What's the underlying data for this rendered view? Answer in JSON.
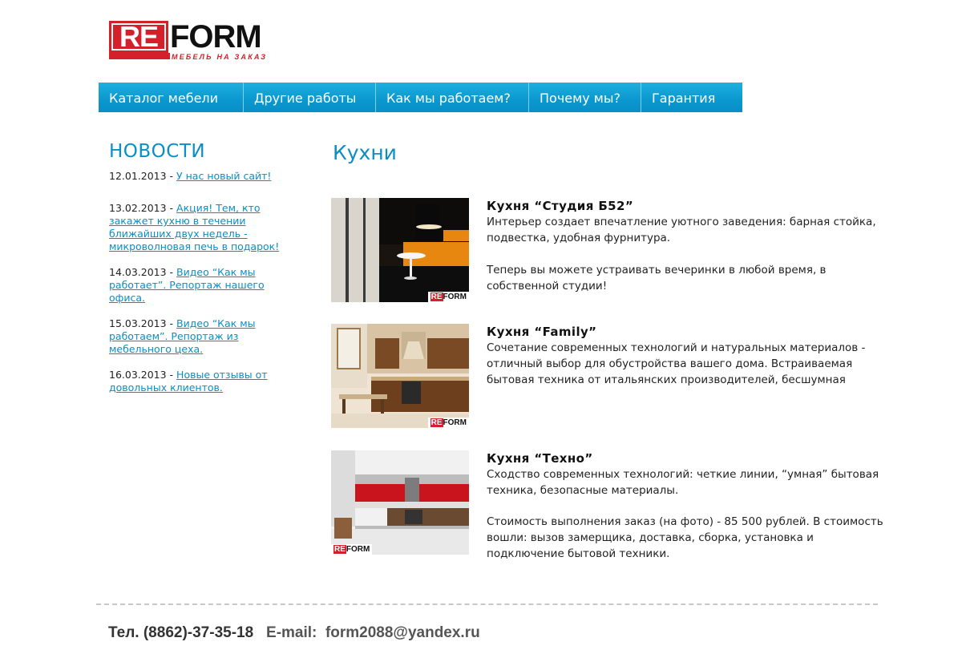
{
  "logo": {
    "re": "RE",
    "form": "FORM",
    "subtitle": "мебель на заказ"
  },
  "nav": [
    "Каталог мебели",
    "Другие работы",
    "Как мы работаем?",
    "Почему мы?",
    "Гарантия"
  ],
  "news": {
    "title": "НОВОСТИ",
    "items": [
      {
        "date": "12.01.2013",
        "text": "У нас новый сайт!"
      },
      {
        "date": "13.02.2013",
        "text": "Акция! Тем, кто закажет кухню в течении ближайших двух недель - микроволновая печь в подарок!"
      },
      {
        "date": "14.03.2013",
        "text": "Видео “Как мы работает”. Репортаж нашего офиса."
      },
      {
        "date": "15.03.2013",
        "text": "Видео “Как мы работаем”. Репортаж из мебельного цеха."
      },
      {
        "date": "16.03.2013",
        "text": "Новые отзывы от довольных клиентов."
      }
    ]
  },
  "main": {
    "title": "Кухни",
    "products": [
      {
        "title": "Кухня “Студия Б52”",
        "paragraphs": [
          "Интерьер создает впечатление уютного заведения: барная стойка, подвестка, удобная фурнитура.",
          "Теперь вы можете устраивать вечеринки в любой время, в собственной студии!"
        ]
      },
      {
        "title": "Кухня “Family”",
        "paragraphs": [
          "Сочетание современных технологий и натуральных материалов - отличный выбор для обустройства вашего дома. Встраиваемая бытовая техника от итальянских производителей, бесшумная"
        ]
      },
      {
        "title": "Кухня “Техно”",
        "paragraphs": [
          "Сходство современных технологий: четкие линии, “умная” бытовая  техника, безопасные материалы.",
          "Стоимость выполнения заказ (на фото) - 85 500 рублей. В стоимость вошли: вызов замерщика, доставка, сборка, установка и подключение бытовой техники."
        ]
      }
    ],
    "badge": {
      "re": "RE",
      "form": "FORM"
    }
  },
  "footer": {
    "phone_label": "Тел.",
    "phone": "(8862)-37-35-18",
    "email_label": "E-mail:",
    "email": "form2088@yandex.ru"
  }
}
